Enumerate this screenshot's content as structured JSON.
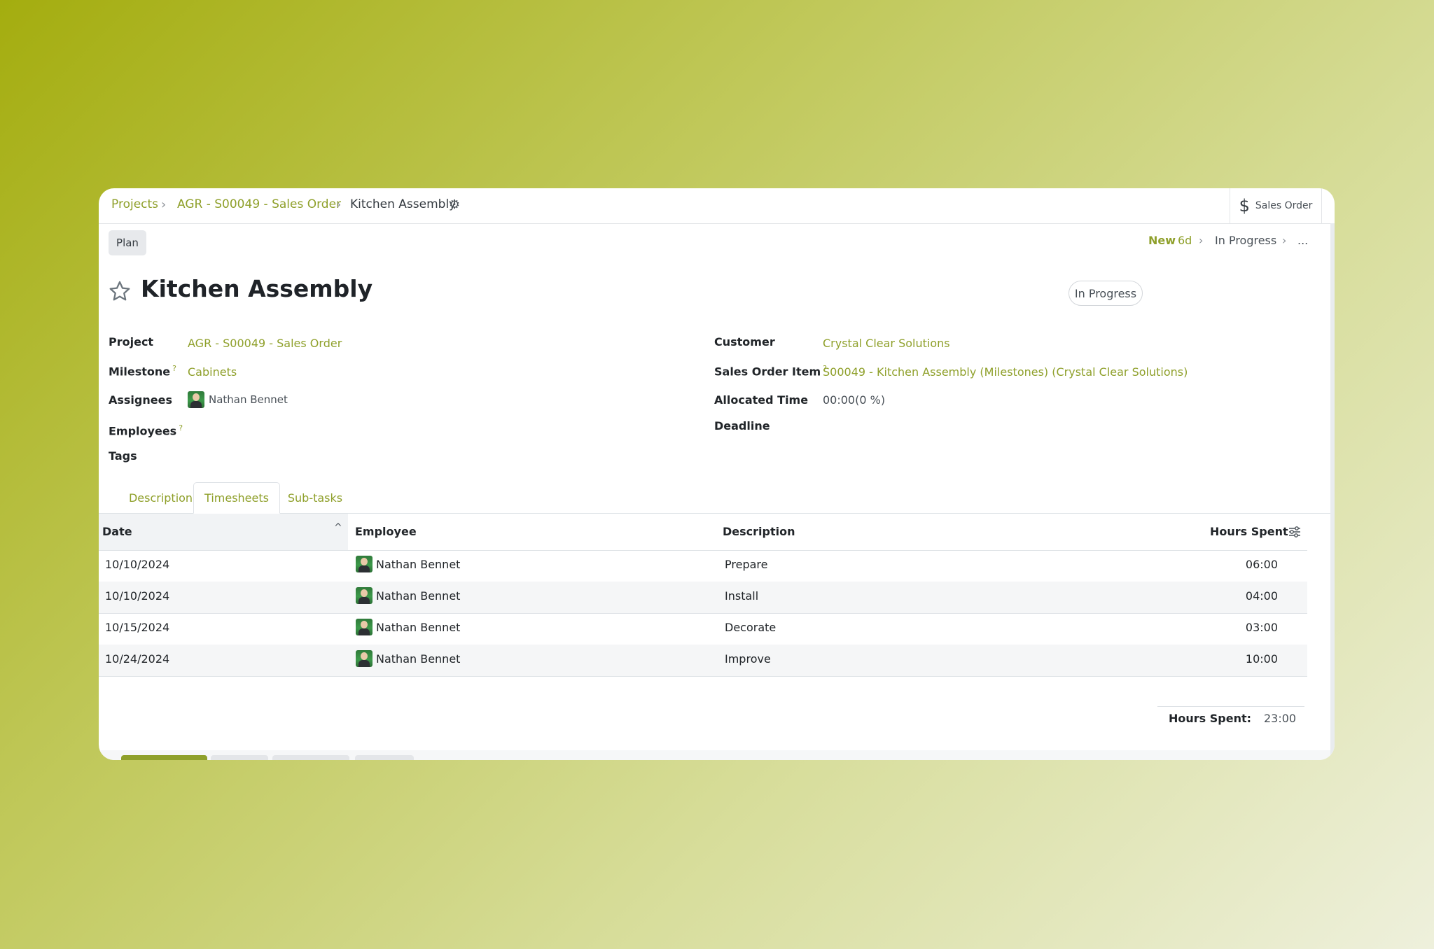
{
  "breadcrumb": {
    "projects": "Projects",
    "sales_order": "AGR - S00049 - Sales Order",
    "current": "Kitchen Assembly",
    "sep": "›"
  },
  "header": {
    "sales_order_button": "Sales Order",
    "dollar_glyph": "$",
    "plan_button": "Plan",
    "stage_new": "New",
    "stage_new_duration": "6d",
    "stage_in_progress": "In Progress",
    "stage_more": "...",
    "stage_sep": "›"
  },
  "task": {
    "title": "Kitchen Assembly",
    "status": "In Progress"
  },
  "fields": {
    "project_label": "Project",
    "project_value": "AGR - S00049 - Sales Order",
    "milestone_label": "Milestone",
    "milestone_value": "Cabinets",
    "assignees_label": "Assignees",
    "assignees_value": "Nathan Bennet",
    "employees_label": "Employees",
    "tags_label": "Tags",
    "customer_label": "Customer",
    "customer_value": "Crystal Clear Solutions",
    "sales_order_item_label": "Sales Order Item",
    "sales_order_item_value": "S00049 - Kitchen Assembly (Milestones) (Crystal Clear Solutions)",
    "allocated_time_label": "Allocated Time",
    "allocated_time_value": "00:00(0 %)",
    "deadline_label": "Deadline",
    "help_mark": "?"
  },
  "tabs": {
    "description": "Description",
    "timesheets": "Timesheets",
    "subtasks": "Sub-tasks"
  },
  "table": {
    "headers": {
      "date": "Date",
      "employee": "Employee",
      "description": "Description",
      "hours": "Hours Spent"
    },
    "sort_glyph": "^",
    "rows": [
      {
        "date": "10/10/2024",
        "employee": "Nathan Bennet",
        "description": "Prepare",
        "hours": "06:00"
      },
      {
        "date": "10/10/2024",
        "employee": "Nathan Bennet",
        "description": "Install",
        "hours": "04:00"
      },
      {
        "date": "10/15/2024",
        "employee": "Nathan Bennet",
        "description": "Decorate",
        "hours": "03:00"
      },
      {
        "date": "10/24/2024",
        "employee": "Nathan Bennet",
        "description": "Improve",
        "hours": "10:00"
      }
    ],
    "total_label": "Hours Spent:",
    "total_value": "23:00"
  },
  "colors": {
    "accent": "#8fa02b",
    "background_start": "#a4ad0f"
  }
}
